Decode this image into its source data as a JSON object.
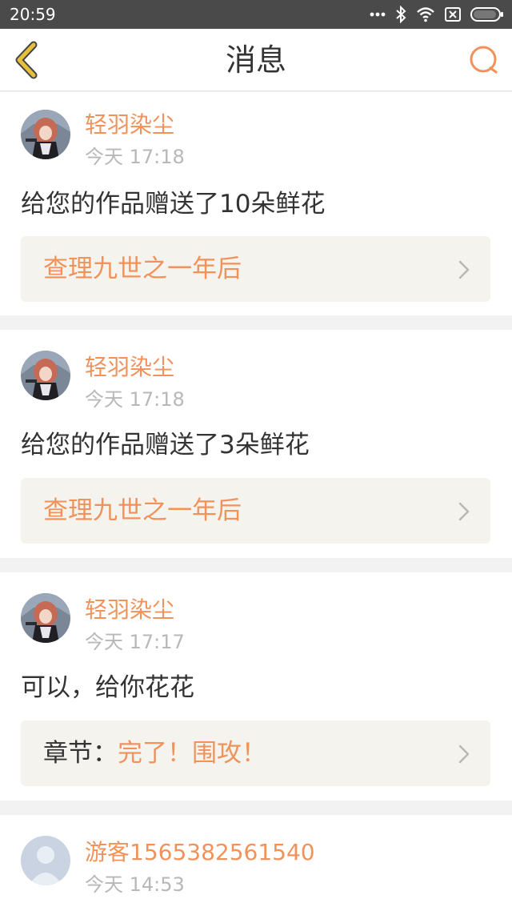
{
  "status_bar": {
    "time": "20:59",
    "icons": [
      "dots-icon",
      "bluetooth-icon",
      "wifi-icon",
      "no-sim-icon",
      "battery-icon"
    ]
  },
  "header": {
    "title": "消息",
    "back_icon": "back-chevron-icon",
    "search_icon": "search-icon",
    "accent_color": "#f0925a",
    "back_color": "#e6c03a"
  },
  "messages": [
    {
      "user": "轻羽染尘",
      "time": "今天 17:18",
      "text": "给您的作品赠送了10朵鲜花",
      "work_title": "查理九世之一年后"
    },
    {
      "user": "轻羽染尘",
      "time": "今天 17:18",
      "text": "给您的作品赠送了3朵鲜花",
      "work_title": "查理九世之一年后"
    },
    {
      "user": "轻羽染尘",
      "time": "今天 17:17",
      "text": "可以，给你花花",
      "chapter_prefix": "章节：",
      "chapter_title": "完了！围攻！"
    },
    {
      "user": "游客1565382561540",
      "time": "今天 14:53"
    }
  ]
}
